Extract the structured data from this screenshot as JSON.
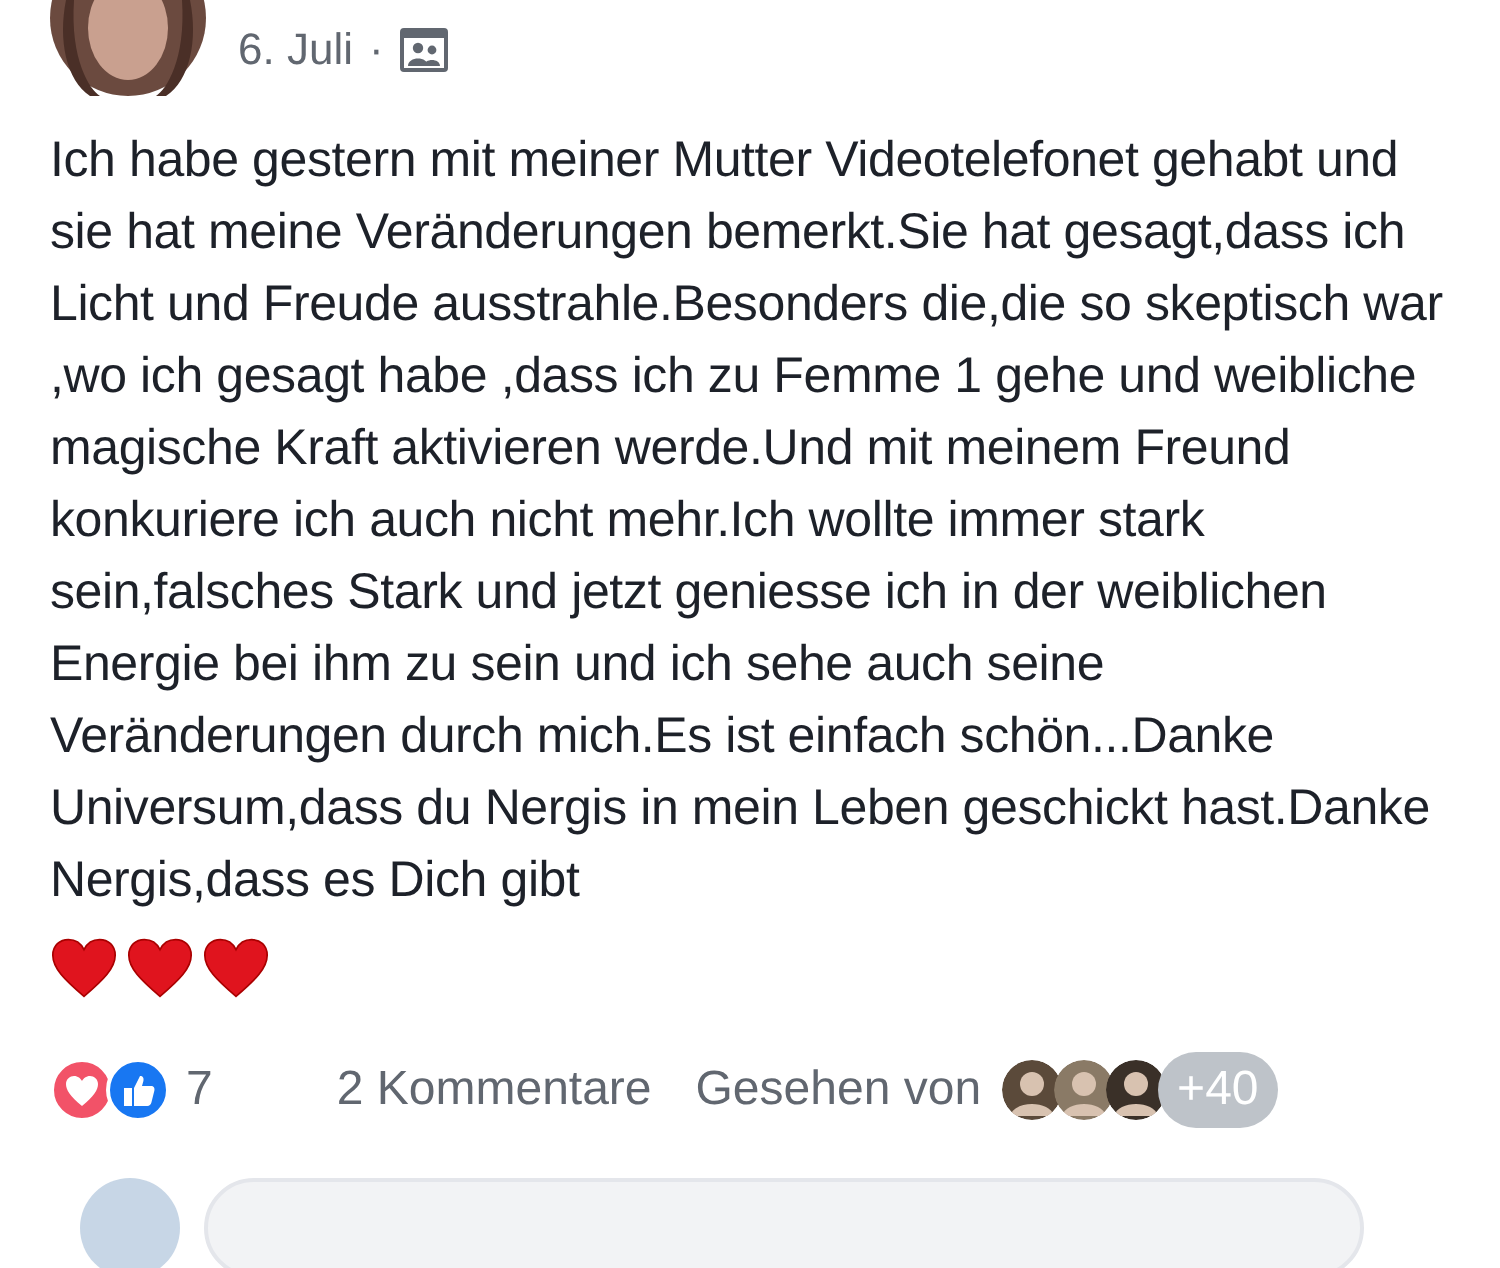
{
  "post": {
    "date": "6. Juli",
    "separator": "·",
    "text": "Ich habe gestern mit meiner Mutter Videotelefonet gehabt und sie hat meine Veränderungen bemerkt.Sie hat gesagt,dass ich Licht und Freude ausstrahle.Besonders die,die so skeptisch war ,wo ich gesagt habe ,dass ich zu Femme 1 gehe und weibliche magische Kraft aktivieren werde.Und mit meinem Freund konkuriere ich auch nicht mehr.Ich wollte immer stark sein,falsches Stark und jetzt geniesse ich in der weiblichen Energie bei ihm zu sein und ich sehe auch seine Veränderungen durch mich.Es ist einfach schön...Danke Universum,dass du Nergis in mein Leben geschickt hast.Danke Nergis,dass es Dich gibt"
  },
  "footer": {
    "reaction_count": "7",
    "comments": "2 Kommentare",
    "seen_by": "Gesehen von",
    "seen_more": "+40"
  }
}
